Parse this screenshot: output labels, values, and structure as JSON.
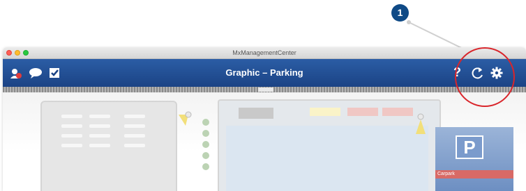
{
  "callout": {
    "number": "1"
  },
  "window": {
    "title": "MxManagementCenter"
  },
  "appbar": {
    "title": "Graphic – Parking",
    "left_icons": [
      "user-alarm-icon",
      "speech-bubble-icon",
      "checkbox-icon"
    ],
    "help_label": "?",
    "right_icons": [
      "help-icon",
      "refresh-icon",
      "gear-icon"
    ]
  },
  "graphic": {
    "parking_symbol": "P",
    "parking_label": "Carpark"
  },
  "colors": {
    "appbar": "#1f4a8c",
    "callout": "#0f4a86",
    "highlight": "#d9252b"
  }
}
